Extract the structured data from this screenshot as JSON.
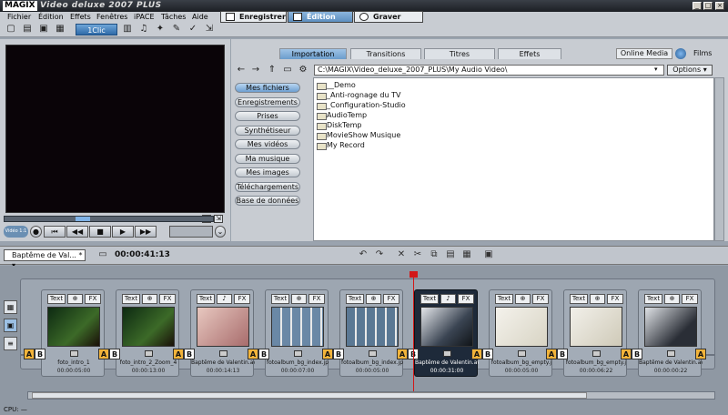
{
  "window": {
    "brand": "MAGIX",
    "title": "Video deluxe 2007 PLUS",
    "controls": [
      "_",
      "□",
      "×"
    ]
  },
  "menu": [
    "Fichier",
    "Édition",
    "Effets",
    "Fenêtres",
    "iPACE",
    "Tâches",
    "Aide"
  ],
  "toolbar": {
    "oneclic_label": "1Clic"
  },
  "modes": {
    "record": "Enregistrer",
    "edit": "Édition",
    "burn": "Graver"
  },
  "browser": {
    "tabs": [
      "Importation",
      "Transitions",
      "Titres",
      "Effets"
    ],
    "online_media": "Online Media",
    "films": "Films",
    "path": "C:\\MAGIX\\Video_deluxe_2007_PLUS\\My Audio Video\\",
    "options_label": "Options",
    "sources": [
      "Mes fichiers",
      "Enregistrements",
      "Prises",
      "Synthétiseur",
      "Mes vidéos",
      "Ma musique",
      "Mes images",
      "Téléchargements",
      "Base de données"
    ],
    "files": [
      "__Demo",
      "_Anti-rognage du TV",
      "_Configuration-Studio",
      "AudioTemp",
      "DiskTemp",
      "MovieShow Musique",
      "My Record"
    ]
  },
  "timeline": {
    "project": "Baptême de Val... *",
    "timecode": "00:00:41:13",
    "cpu_label": "CPU:",
    "cpu_value": "—",
    "clips": [
      {
        "name": "foto_intro_1",
        "duration": "00:00:05:00",
        "chip": "Text",
        "fx": "FX"
      },
      {
        "name": "foto_intro_2_Zoom_4",
        "duration": "00:00:13:00",
        "chip": "Text",
        "fx": "FX"
      },
      {
        "name": "Baptême de Valentin.avi",
        "duration": "00:00:14:13",
        "chip": "Text",
        "fx": "FX"
      },
      {
        "name": "fotoalbum_bg_index.jp",
        "duration": "00:00:07:00",
        "chip": "Text",
        "fx": "FX"
      },
      {
        "name": "fotoalbum_bg_index.jp",
        "duration": "00:00:05:00",
        "chip": "Text",
        "fx": "FX"
      },
      {
        "name": "Baptême de Valentin.avi",
        "duration": "00:00:31:00",
        "chip": "Text",
        "fx": "FX"
      },
      {
        "name": "fotoalbum_bg_empty.j",
        "duration": "00:00:05:00",
        "chip": "Text",
        "fx": "FX"
      },
      {
        "name": "fotoalbum_bg_empty.j",
        "duration": "00:00:06:22",
        "chip": "Text",
        "fx": "FX"
      },
      {
        "name": "Baptême de Valentin.avi",
        "duration": "00:00:00:22",
        "chip": "Text",
        "fx": "FX"
      }
    ]
  },
  "player": {
    "mode_label": "Vidéo 1:1"
  },
  "colors": {
    "accent": "#6b9dcc",
    "playhead": "#d21818",
    "transition": "#f2b33a"
  }
}
